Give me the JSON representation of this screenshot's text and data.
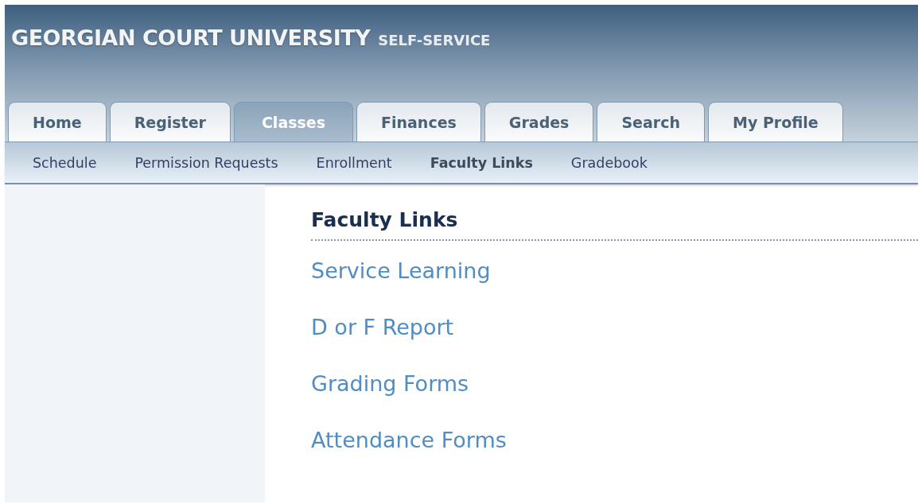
{
  "header": {
    "title": "GEORGIAN COURT UNIVERSITY",
    "subtitle": "SELF-SERVICE"
  },
  "tabs": [
    {
      "label": "Home",
      "selected": false
    },
    {
      "label": "Register",
      "selected": false
    },
    {
      "label": "Classes",
      "selected": true
    },
    {
      "label": "Finances",
      "selected": false
    },
    {
      "label": "Grades",
      "selected": false
    },
    {
      "label": "Search",
      "selected": false
    },
    {
      "label": "My Profile",
      "selected": false
    }
  ],
  "subnav": [
    {
      "label": "Schedule",
      "selected": false
    },
    {
      "label": "Permission Requests",
      "selected": false
    },
    {
      "label": "Enrollment",
      "selected": false
    },
    {
      "label": "Faculty Links",
      "selected": true
    },
    {
      "label": "Gradebook",
      "selected": false
    }
  ],
  "content": {
    "heading": "Faculty Links",
    "links": [
      "Service Learning",
      "D or F Report",
      "Grading Forms",
      "Attendance Forms"
    ]
  }
}
